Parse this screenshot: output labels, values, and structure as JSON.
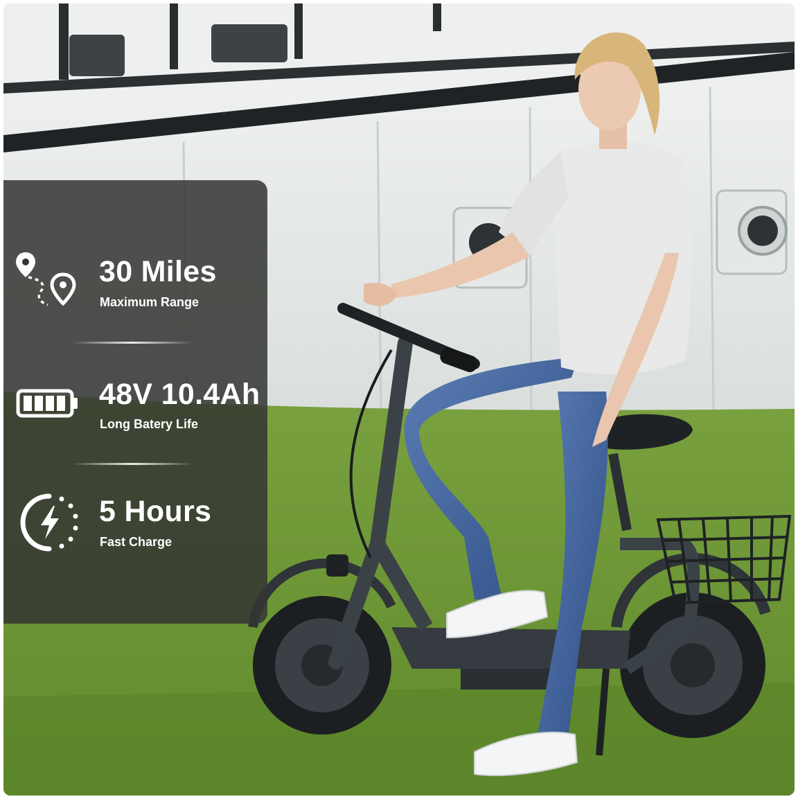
{
  "features": [
    {
      "title": "30 Miles",
      "subtitle": "Maximum Range",
      "icon": "route-pin-icon"
    },
    {
      "title": "48V 10.4Ah",
      "subtitle": "Long Batery Life",
      "icon": "battery-icon"
    },
    {
      "title": "5 Hours",
      "subtitle": "Fast Charge",
      "icon": "fast-charge-icon"
    }
  ],
  "colors": {
    "panel": "#343632",
    "text": "#ffffff",
    "grass": "#6f8f3a",
    "ship_hull": "#e8ebea",
    "scooter": "#3b4247"
  },
  "photo": {
    "subject": "woman seated on seated electric scooter with rear basket, white ship hull background, grass lawn"
  }
}
